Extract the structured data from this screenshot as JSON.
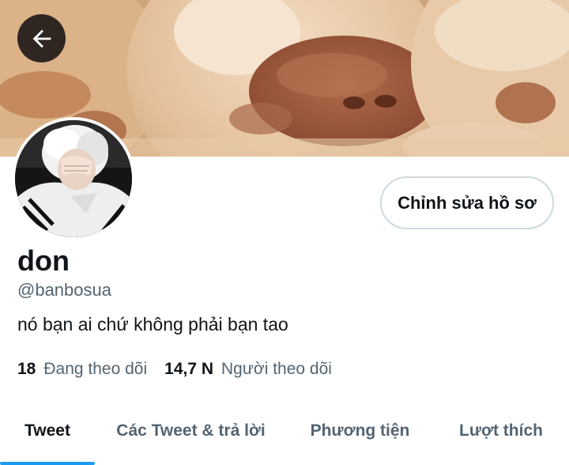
{
  "header": {
    "back_icon": "arrow-left-icon"
  },
  "profile": {
    "display_name": "don",
    "handle": "@banbosua",
    "bio": "nó bạn ai chứ không phải bạn tao",
    "edit_button_label": "Chỉnh sửa hồ sơ",
    "avatar_icon": "profile-photo"
  },
  "stats": {
    "following_count": "18",
    "following_label": "Đang theo dõi",
    "followers_count": "14,7 N",
    "followers_label": "Người theo dõi"
  },
  "tabs": [
    {
      "label": "Tweet",
      "active": true
    },
    {
      "label": "Các Tweet & trả lời",
      "active": false
    },
    {
      "label": "Phương tiện",
      "active": false
    },
    {
      "label": "Lượt thích",
      "active": false
    }
  ],
  "colors": {
    "primary_text": "#0f1419",
    "secondary_text": "#536471",
    "accent": "#1d9bf0",
    "border": "#cfd9de"
  }
}
